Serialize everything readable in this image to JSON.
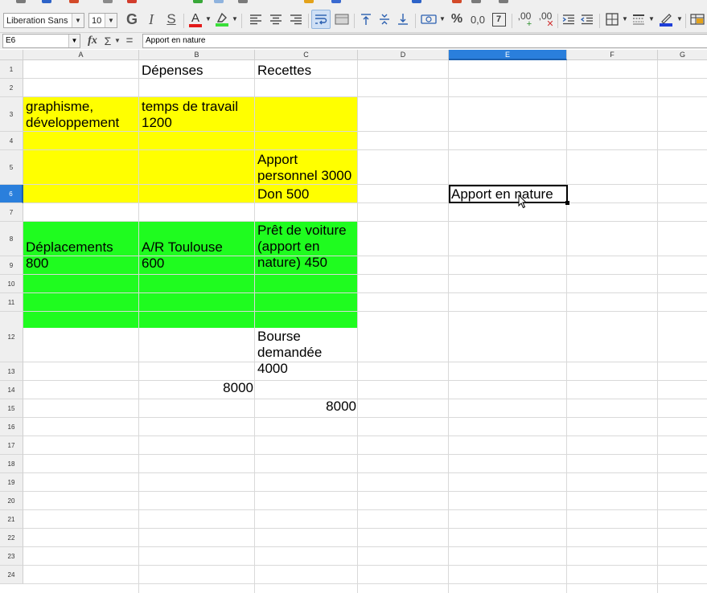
{
  "toolbar": {
    "font_name": "Liberation Sans",
    "font_size": "10",
    "bold_glyph": "G",
    "italic_glyph": "I",
    "underline_glyph": "S",
    "font_color_glyph": "A",
    "font_color": "#e31b1b",
    "highlight_color": "#3adf3a",
    "percent_glyph": "%",
    "decimal_glyph": "0,0",
    "number_glyph": "7",
    "add_decimal_glyph": ",00",
    "del_decimal_glyph": ",00",
    "border_color": "#1f3fd8"
  },
  "formula_bar": {
    "cell_ref": "E6",
    "fx": "fx",
    "sum": "Σ",
    "equals": "=",
    "content": "Apport en nature"
  },
  "columns": [
    "A",
    "B",
    "C",
    "D",
    "E",
    "F",
    "G"
  ],
  "selected_column": "E",
  "rows": [
    "1",
    "2",
    "3",
    "4",
    "5",
    "6",
    "7",
    "8",
    "9",
    "10",
    "11",
    "12",
    "13",
    "14",
    "15",
    "16",
    "17",
    "18",
    "19",
    "20",
    "21",
    "22",
    "23",
    "24"
  ],
  "selected_row": "6",
  "colors": {
    "yellow_block": "#ffff00",
    "green_block": "#1ffc1f",
    "selection_header": "#2a7fdc"
  },
  "cells": {
    "B1": "Dépenses",
    "C1": "Recettes",
    "A3": "graphisme,\ndéveloppement",
    "B3": "temps de travail\n1200",
    "C5": "Apport\npersonnel 3000",
    "C6": "Don 500",
    "E6": "Apport en nature",
    "A8": "Déplacements\n800",
    "B8": "A/R Toulouse\n600",
    "C8": "Prêt de voiture\n(apport en\nnature) 450",
    "C12": "Bourse\ndemandée\n4000",
    "B13": "8000",
    "C14": "8000"
  }
}
